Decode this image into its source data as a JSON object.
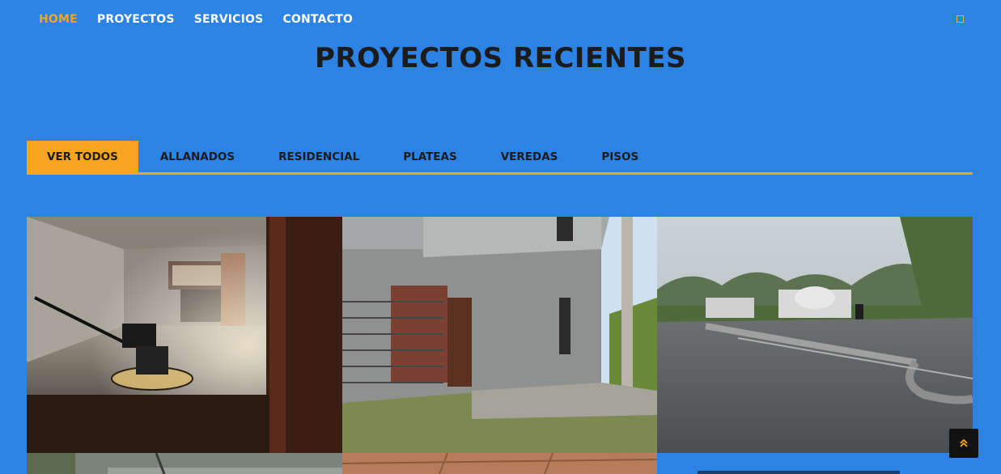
{
  "nav": {
    "items": [
      "HOME",
      "PROYECTOS",
      "SERVICIOS",
      "CONTACTO"
    ],
    "active": "HOME",
    "toggle_icon": "square-outline-icon"
  },
  "section": {
    "title": "PROYECTOS RECIENTES"
  },
  "filters": {
    "tabs": [
      "VER TODOS",
      "ALLANADOS",
      "RESIDENCIAL",
      "PLATEAS",
      "VEREDAS",
      "PISOS"
    ],
    "active": "VER TODOS"
  },
  "gallery": {
    "items": [
      {
        "name": "project-photo-floor-trowel"
      },
      {
        "name": "project-photo-residential-house"
      },
      {
        "name": "project-photo-concrete-pouring"
      },
      {
        "name": "project-photo-partial-1"
      },
      {
        "name": "project-photo-partial-2"
      },
      {
        "name": "project-photo-partial-3"
      }
    ]
  },
  "colors": {
    "background": "#2c83e3",
    "accent": "#f7a51e",
    "title": "#1b1b1b"
  },
  "scroll_top": {
    "icon": "double-chevron-up-icon"
  }
}
